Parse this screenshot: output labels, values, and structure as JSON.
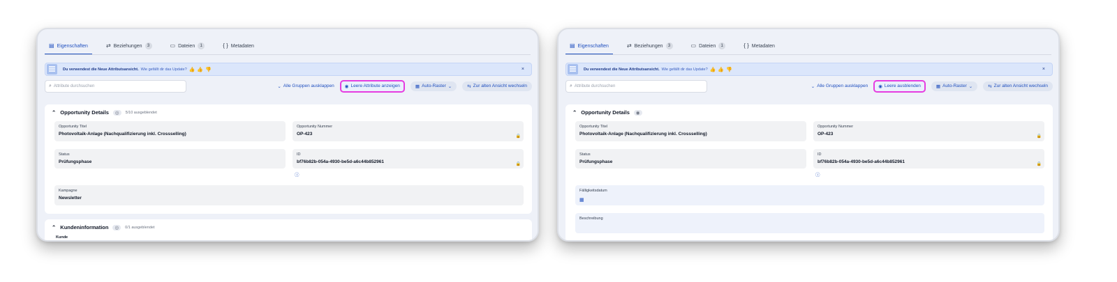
{
  "tabs": [
    {
      "label": "Eigenschaften",
      "icon": "properties-icon"
    },
    {
      "label": "Beziehungen",
      "icon": "relations-icon",
      "count": "3"
    },
    {
      "label": "Dateien",
      "icon": "folder-icon",
      "count": "1"
    },
    {
      "label": "Metadaten",
      "icon": "braces-icon"
    }
  ],
  "banner": {
    "message": "Du verwendest die Neue Attributsansicht.",
    "question": "Wie gefällt dir das Update?",
    "close": "×"
  },
  "search": {
    "placeholder": "Attribute durchsuchen"
  },
  "toolbar": {
    "expand_all": "Alle Gruppen ausklappen",
    "grid": "Auto-Raster",
    "old_view": "Zur alten Ansicht wechseln"
  },
  "left": {
    "toggle_empty": "Leere Attribute anzeigen",
    "group": {
      "title": "Opportunity Details",
      "hidden_note": "5/10 ausgeblendet"
    },
    "fields": [
      {
        "label": "Opportunity Titel",
        "value": "Photovoltaik-Anlage (Nachqualifizierung inkl. Crossselling)"
      },
      {
        "label": "Opportunity Nummer",
        "value": "OP-423"
      },
      {
        "label": "Status",
        "value": "Prüfungsphase"
      },
      {
        "label": "ID",
        "value": "bf76b82b-054a-4930-be5d-a6c44b852961"
      },
      {
        "label": "Kampagne",
        "value": "Newsletter"
      }
    ],
    "group2": {
      "title": "Kundeninformation",
      "hidden_note": "0/1 ausgeblendet",
      "first_field": "Kunde"
    }
  },
  "right": {
    "toggle_empty": "Leere ausblenden",
    "group": {
      "title": "Opportunity Details"
    },
    "fields": [
      {
        "label": "Opportunity Titel",
        "value": "Photovoltaik-Anlage (Nachqualifizierung inkl. Crossselling)"
      },
      {
        "label": "Opportunity Nummer",
        "value": "OP-423"
      },
      {
        "label": "Status",
        "value": "Prüfungsphase"
      },
      {
        "label": "ID",
        "value": "bf76b82b-054a-4930-be5d-a6c44b852961"
      },
      {
        "label": "Fälligkeitsdatum",
        "value": ""
      },
      {
        "label": "Beschreibung",
        "value": ""
      }
    ]
  },
  "colors": {
    "accent": "#1f4fbf",
    "highlight": "#e63ce0",
    "panel_bg": "#eef1f8"
  }
}
